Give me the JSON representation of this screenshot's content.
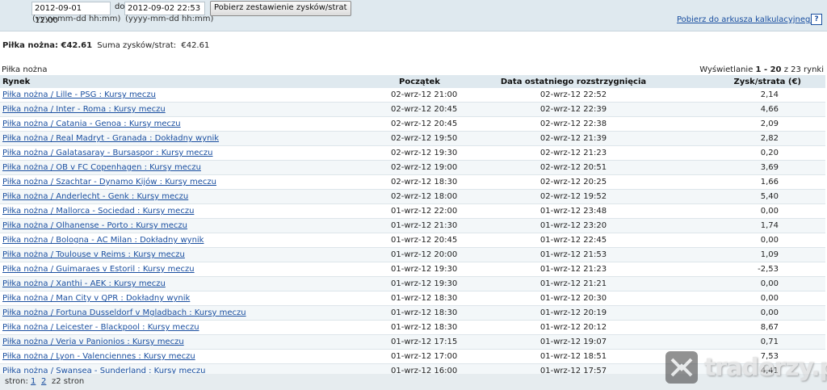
{
  "filters": {
    "from_value": "2012-09-01 12:00",
    "to_label": "do",
    "to_value": "2012-09-02 22:53",
    "format_hint_from": "(yyyy-mm-dd hh:mm)",
    "format_hint_to": "(yyyy-mm-dd hh:mm)",
    "submit_label": "Pobierz zestawienie zysków/strat"
  },
  "export": {
    "link_label": "Pobierz do arkusza kalkulacyjnego",
    "help_icon": "?"
  },
  "summary": {
    "sport_label": "Piłka nożna: €42.61",
    "total_label": "Suma zysków/strat:",
    "total_value": "€42.61"
  },
  "section": {
    "label": "Piłka nożna",
    "display_prefix": "Wyświetlanie",
    "display_range": "1 - 20",
    "display_suffix": "z 23 rynki"
  },
  "table": {
    "headers": [
      "Rynek",
      "Początek",
      "Data ostatniego rozstrzygnięcia",
      "Zysk/strata (€)"
    ],
    "rows": [
      [
        "Piłka nożna / Lille - PSG : Kursy meczu",
        "02-wrz-12 21:00",
        "02-wrz-12 22:52",
        "2,14"
      ],
      [
        "Piłka nożna / Inter - Roma : Kursy meczu",
        "02-wrz-12 20:45",
        "02-wrz-12 22:39",
        "4,66"
      ],
      [
        "Piłka nożna / Catania - Genoa : Kursy meczu",
        "02-wrz-12 20:45",
        "02-wrz-12 22:38",
        "2,09"
      ],
      [
        "Piłka nożna / Real Madryt - Granada : Dokładny wynik",
        "02-wrz-12 19:50",
        "02-wrz-12 21:39",
        "2,82"
      ],
      [
        "Piłka nożna / Galatasaray - Bursaspor : Kursy meczu",
        "02-wrz-12 19:30",
        "02-wrz-12 21:23",
        "0,20"
      ],
      [
        "Piłka nożna / OB v FC Copenhagen : Kursy meczu",
        "02-wrz-12 19:00",
        "02-wrz-12 20:51",
        "3,69"
      ],
      [
        "Piłka nożna / Szachtar - Dynamo Kijów : Kursy meczu",
        "02-wrz-12 18:30",
        "02-wrz-12 20:25",
        "1,66"
      ],
      [
        "Piłka nożna / Anderlecht - Genk : Kursy meczu",
        "02-wrz-12 18:00",
        "02-wrz-12 19:52",
        "5,40"
      ],
      [
        "Piłka nożna / Mallorca - Sociedad : Kursy meczu",
        "01-wrz-12 22:00",
        "01-wrz-12 23:48",
        "0,00"
      ],
      [
        "Piłka nożna / Olhanense - Porto : Kursy meczu",
        "01-wrz-12 21:30",
        "01-wrz-12 23:20",
        "1,74"
      ],
      [
        "Piłka nożna / Bologna - AC Milan : Dokładny wynik",
        "01-wrz-12 20:45",
        "01-wrz-12 22:45",
        "0,00"
      ],
      [
        "Piłka nożna / Toulouse v Reims : Kursy meczu",
        "01-wrz-12 20:00",
        "01-wrz-12 21:53",
        "1,09"
      ],
      [
        "Piłka nożna / Guimaraes v Estoril : Kursy meczu",
        "01-wrz-12 19:30",
        "01-wrz-12 21:23",
        "-2,53"
      ],
      [
        "Piłka nożna / Xanthi - AEK : Kursy meczu",
        "01-wrz-12 19:30",
        "01-wrz-12 21:21",
        "0,00"
      ],
      [
        "Piłka nożna / Man City v QPR : Dokładny wynik",
        "01-wrz-12 18:30",
        "01-wrz-12 20:30",
        "0,00"
      ],
      [
        "Piłka nożna / Fortuna Dusseldorf v Mgladbach : Kursy meczu",
        "01-wrz-12 18:30",
        "01-wrz-12 20:19",
        "0,00"
      ],
      [
        "Piłka nożna / Leicester - Blackpool : Kursy meczu",
        "01-wrz-12 18:30",
        "01-wrz-12 20:12",
        "8,67"
      ],
      [
        "Piłka nożna / Veria v Panionios : Kursy meczu",
        "01-wrz-12 17:15",
        "01-wrz-12 19:07",
        "0,71"
      ],
      [
        "Piłka nożna / Lyon - Valenciennes : Kursy meczu",
        "01-wrz-12 17:00",
        "01-wrz-12 18:51",
        "7,53"
      ],
      [
        "Piłka nożna / Swansea - Sunderland : Kursy meczu",
        "01-wrz-12 16:00",
        "01-wrz-12 17:57",
        "4,41"
      ]
    ]
  },
  "pager": {
    "pages_label": "stron:",
    "page_1": "1",
    "page_2": "2",
    "total_label": "z2 stron"
  },
  "watermark": {
    "text": "traderzy.pl"
  }
}
